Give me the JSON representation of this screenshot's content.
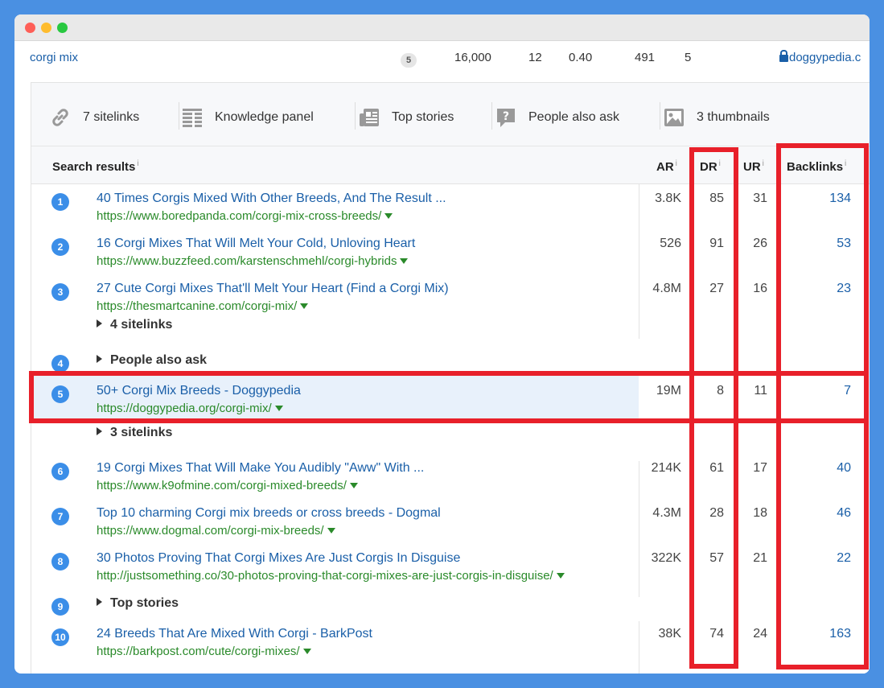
{
  "keyword_row": {
    "keyword": "corgi mix",
    "kd": "5",
    "volume": "16,000",
    "col3": "12",
    "cpc": "0.40",
    "col5": "491",
    "col6": "5",
    "domain": "doggypedia.c"
  },
  "features": [
    {
      "label": "7 sitelinks",
      "icon": "link-icon"
    },
    {
      "label": "Knowledge panel",
      "icon": "knowledge-panel-icon"
    },
    {
      "label": "Top stories",
      "icon": "newspaper-icon"
    },
    {
      "label": "People also ask",
      "icon": "question-bubble-icon"
    },
    {
      "label": "3 thumbnails",
      "icon": "image-icon"
    }
  ],
  "table": {
    "headers": {
      "results": "Search results",
      "ar": "AR",
      "dr": "DR",
      "ur": "UR",
      "backlinks": "Backlinks",
      "info": "i"
    },
    "rows": [
      {
        "pos": "1",
        "title": "40 Times Corgis Mixed With Other Breeds, And The Result ...",
        "url": "https://www.boredpanda.com/corgi-mix-cross-breeds/",
        "ar": "3.8K",
        "dr": "85",
        "ur": "31",
        "backlinks": "134"
      },
      {
        "pos": "2",
        "title": "16 Corgi Mixes That Will Melt Your Cold, Unloving Heart",
        "url": "https://www.buzzfeed.com/karstenschmehl/corgi-hybrids",
        "ar": "526",
        "dr": "91",
        "ur": "26",
        "backlinks": "53"
      },
      {
        "pos": "3",
        "title": "27 Cute Corgi Mixes That'll Melt Your Heart (Find a Corgi Mix)",
        "url": "https://thesmartcanine.com/corgi-mix/",
        "ar": "4.8M",
        "dr": "27",
        "ur": "16",
        "backlinks": "23",
        "extra": "4 sitelinks"
      },
      {
        "pos": "4",
        "label": "People also ask"
      },
      {
        "pos": "5",
        "title": "50+ Corgi Mix Breeds - Doggypedia",
        "url": "https://doggypedia.org/corgi-mix/",
        "ar": "19M",
        "dr": "8",
        "ur": "11",
        "backlinks": "7",
        "extra": "3 sitelinks"
      },
      {
        "pos": "6",
        "title": "19 Corgi Mixes That Will Make You Audibly \"Aww\" With ...",
        "url": "https://www.k9ofmine.com/corgi-mixed-breeds/",
        "ar": "214K",
        "dr": "61",
        "ur": "17",
        "backlinks": "40"
      },
      {
        "pos": "7",
        "title": "Top 10 charming Corgi mix breeds or cross breeds - Dogmal",
        "url": "https://www.dogmal.com/corgi-mix-breeds/",
        "ar": "4.3M",
        "dr": "28",
        "ur": "18",
        "backlinks": "46"
      },
      {
        "pos": "8",
        "title": "30 Photos Proving That Corgi Mixes Are Just Corgis In Disguise",
        "url": "http://justsomething.co/30-photos-proving-that-corgi-mixes-are-just-corgis-in-disguise/",
        "ar": "322K",
        "dr": "57",
        "ur": "21",
        "backlinks": "22"
      },
      {
        "pos": "9",
        "label": "Top stories"
      },
      {
        "pos": "10",
        "title": "24 Breeds That Are Mixed With Corgi - BarkPost",
        "url": "https://barkpost.com/cute/corgi-mixes/",
        "ar": "38K",
        "dr": "74",
        "ur": "24",
        "backlinks": "163"
      }
    ]
  },
  "colors": {
    "highlight": "#e8202a",
    "link": "#1a5fa8",
    "url": "#2a8a2a",
    "badge": "#3b8ee8"
  }
}
